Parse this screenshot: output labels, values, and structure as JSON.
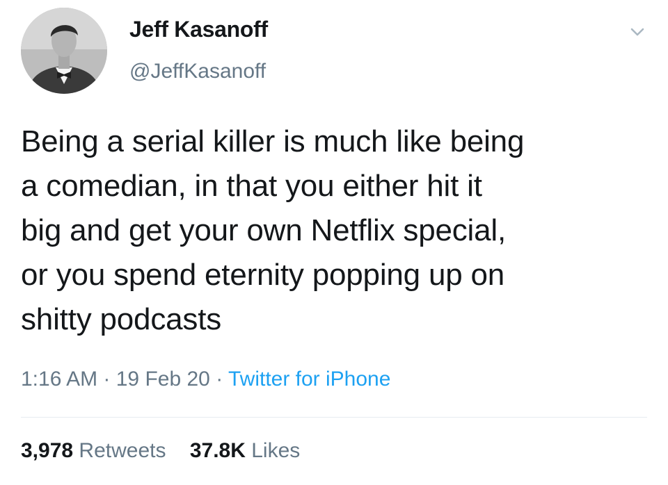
{
  "author": {
    "display_name": "Jeff Kasanoff",
    "handle": "@JeffKasanoff"
  },
  "tweet": {
    "text": "Being a serial killer is much like being\na comedian, in that you either hit it\nbig and get your own Netflix special,\nor you spend eternity popping up on\nshitty podcasts"
  },
  "meta": {
    "time": "1:16 AM",
    "separator": " · ",
    "date": "19 Feb 20",
    "source": "Twitter for iPhone"
  },
  "stats": {
    "retweets_count": "3,978",
    "retweets_label": "Retweets",
    "likes_count": "37.8K",
    "likes_label": "Likes"
  },
  "icons": {
    "menu": "chevron-down-icon",
    "avatar": "profile-photo"
  },
  "colors": {
    "text_primary": "#14171a",
    "text_secondary": "#657786",
    "link": "#1da1f2",
    "divider": "#e6ecf0"
  }
}
